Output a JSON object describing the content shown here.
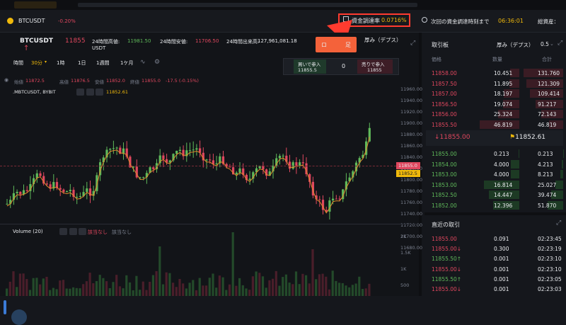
{
  "topbar": {
    "symbol": "BTCUSDT",
    "change": "-0.20%",
    "funding_label": "資金調達率",
    "funding_rate": "0.0716%",
    "next_funding_label": "次回の資金調達時刻まで",
    "countdown": "06:36:01",
    "total_assets_label": "総資産："
  },
  "ticker": {
    "symbol": "BTCUSDT",
    "last_price": "11855",
    "high_label": "24時間高値:",
    "high": "11981.50",
    "low_label": "24時間安値:",
    "low": "11706.50",
    "volume_label": "24時間出来高:",
    "volume": "127,961,081.18",
    "unit": "USDT",
    "chart_tab": "ロ",
    "chart_tab2": "足",
    "depth_tab": "厚み（デプス）"
  },
  "toolbar": {
    "time_label": "時間",
    "intervals": [
      "30分",
      "1時",
      "1日",
      "1週間",
      "1ケ月"
    ]
  },
  "ohlc": {
    "open_label": "始値",
    "open": "11872.5",
    "high_label": "高値",
    "high": "11876.5",
    "low_label": "安値",
    "low": "11852.0",
    "close_label": "終値",
    "close": "11855.0",
    "change": "-17.5 (-0.15%)"
  },
  "series": {
    "name": ".MBTCUSDT, BYBIT",
    "marker": "11852.61"
  },
  "trade_box": {
    "buy_label": "買いで参入",
    "buy_price": "11855.5",
    "qty": "0",
    "sell_label": "売りで参入",
    "sell_price": "11855"
  },
  "price_axis": {
    "ticks": [
      "11960.00",
      "11940.00",
      "11920.00",
      "11900.00",
      "11880.00",
      "11860.00",
      "11840.00",
      "11820.00",
      "11800.00",
      "11780.00",
      "11760.00",
      "11740.00",
      "11720.00",
      "11700.00",
      "11680.00"
    ],
    "last_tag": "11855.0",
    "mark_tag": "11852.5"
  },
  "volume": {
    "label": "Volume (20)",
    "na1": "該当なし",
    "na2": "該当なし",
    "ticks": [
      "2K",
      "1.5K",
      "1K",
      "500"
    ]
  },
  "orderbook": {
    "title": "取引板",
    "depth_label": "厚み（デプス）",
    "step": "0.5",
    "col_price": "価格",
    "col_qty": "数量",
    "col_total": "合計",
    "asks": [
      [
        "11858.00",
        "10.451",
        "131.760"
      ],
      [
        "11857.50",
        "11.895",
        "121.309"
      ],
      [
        "11857.00",
        "18.197",
        "109.414"
      ],
      [
        "11856.50",
        "19.074",
        "91.217"
      ],
      [
        "11856.00",
        "25.324",
        "72.143"
      ],
      [
        "11855.50",
        "46.819",
        "46.819"
      ]
    ],
    "last": "11855.00",
    "mark": "11852.61",
    "bids": [
      [
        "11855.00",
        "0.213",
        "0.213"
      ],
      [
        "11854.00",
        "4.000",
        "4.213"
      ],
      [
        "11853.00",
        "4.000",
        "8.213"
      ],
      [
        "11853.00",
        "16.814",
        "25.027"
      ],
      [
        "11852.50",
        "14.447",
        "39.474"
      ],
      [
        "11852.00",
        "12.396",
        "51.870"
      ]
    ]
  },
  "trades": {
    "title": "直近の取引",
    "rows": [
      [
        "11855.00",
        "0.091",
        "02:23:45",
        "r"
      ],
      [
        "11855.00↓",
        "0.300",
        "02:23:19",
        "r"
      ],
      [
        "11855.50↑",
        "0.001",
        "02:23:10",
        "g"
      ],
      [
        "11855.00↓",
        "0.001",
        "02:23:10",
        "r"
      ],
      [
        "11855.50↑",
        "0.001",
        "02:23:05",
        "g"
      ],
      [
        "11855.00↓",
        "0.001",
        "02:23:03",
        "r"
      ]
    ]
  },
  "colors": {
    "up": "#5fb95a",
    "down": "#e0475e",
    "accent": "#f0b90b",
    "annotation": "#ff3b2f"
  }
}
